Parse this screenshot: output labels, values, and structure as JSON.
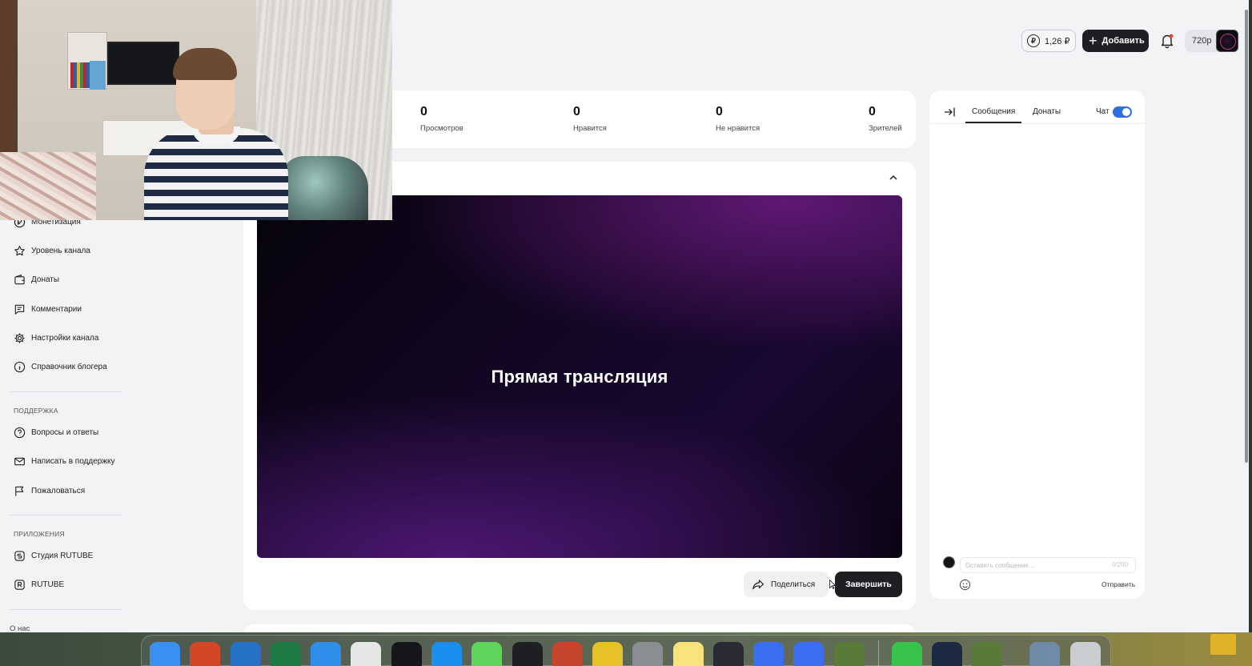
{
  "header": {
    "balance": "1,26 ₽",
    "balance_icon": "ruble-icon",
    "add_label": "Добавить",
    "quality": "720p"
  },
  "sidebar": {
    "items_top": [
      {
        "label": "Монетизация",
        "icon": "ruble-icon"
      },
      {
        "label": "Уровень канала",
        "icon": "star-icon"
      },
      {
        "label": "Донаты",
        "icon": "wallet-icon"
      },
      {
        "label": "Комментарии",
        "icon": "comment-icon"
      },
      {
        "label": "Настройки канала",
        "icon": "gear-icon"
      },
      {
        "label": "Справочник блогера",
        "icon": "info-icon"
      }
    ],
    "support_title": "ПОДДЕРЖКА",
    "support_items": [
      {
        "label": "Вопросы и ответы",
        "icon": "question-icon"
      },
      {
        "label": "Написать в поддержку",
        "icon": "mail-icon"
      },
      {
        "label": "Пожаловаться",
        "icon": "flag-icon"
      }
    ],
    "apps_title": "ПРИЛОЖЕНИЯ",
    "apps_items": [
      {
        "label": "Студия RUTUBE",
        "icon": "studio-icon"
      },
      {
        "label": "RUTUBE",
        "icon": "rutube-icon"
      }
    ],
    "about": "О нас"
  },
  "stats": [
    {
      "value": "0",
      "label": "Просмотров"
    },
    {
      "value": "0",
      "label": "Нравится"
    },
    {
      "value": "0",
      "label": "Не нравится"
    },
    {
      "value": "0",
      "label": "Зрителей"
    }
  ],
  "player": {
    "title": "Прямая трансляция",
    "share_label": "Поделиться",
    "finish_label": "Завершить"
  },
  "chat": {
    "tab_messages": "Сообщения",
    "tab_donations": "Донаты",
    "chat_toggle_label": "Чат",
    "chat_enabled": true,
    "input_placeholder": "Оставить сообщение...",
    "char_count": "0/200",
    "send_label": "Отправить"
  },
  "colors": {
    "accent_toggle": "#2f6fe0",
    "primary_button": "#1e1f22",
    "page_bg": "#f2f3f5"
  },
  "dock": {
    "apps": [
      "finder-icon",
      "powerpoint-icon",
      "outlook-icon",
      "excel-icon",
      "safari-icon",
      "calculator-icon",
      "rutube-icon",
      "app-store-icon",
      "facetime-icon",
      "roblox-studio-icon",
      "game-icon",
      "geometry-dash-icon",
      "system-settings-icon",
      "notes-icon",
      "obs-icon",
      "roblox-icon",
      "roblox-icon-2",
      "minecraft-icon",
      "whatsapp-icon",
      "steam-icon",
      "minecraft-icon-2",
      "folder-icon",
      "trash-icon"
    ]
  }
}
